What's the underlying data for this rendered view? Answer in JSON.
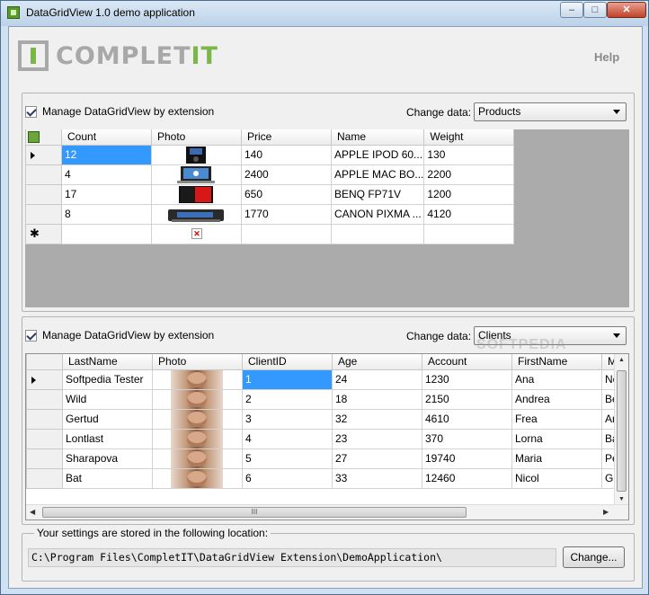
{
  "window": {
    "title": "DataGridView 1.0 demo application",
    "min_glyph": "–",
    "max_glyph": "□",
    "close_glyph": "✕"
  },
  "logo": {
    "text_a": "COMPLET",
    "text_b": "IT"
  },
  "help_label": "Help",
  "products_panel": {
    "checkbox_label": "Manage DataGridView by extension",
    "change_data_label": "Change data:",
    "selected_option": "Products",
    "columns": [
      "Count",
      "Photo",
      "Price",
      "Name",
      "Weight"
    ],
    "rows": [
      {
        "count": "12",
        "price": "140",
        "name": "APPLE IPOD 60...",
        "weight": "130"
      },
      {
        "count": "4",
        "price": "2400",
        "name": "APPLE MAC BO...",
        "weight": "2200"
      },
      {
        "count": "17",
        "price": "650",
        "name": "BENQ FP71V",
        "weight": "1200"
      },
      {
        "count": "8",
        "price": "1770",
        "name": "CANON PIXMA ...",
        "weight": "4120"
      }
    ],
    "new_row_glyph": "✱",
    "broken_glyph": "✕"
  },
  "clients_panel": {
    "checkbox_label": "Manage DataGridView by extension",
    "change_data_label": "Change data:",
    "selected_option": "Clients",
    "columns": [
      "LastName",
      "Photo",
      "ClientID",
      "Age",
      "Account",
      "FirstName",
      "M"
    ],
    "rows": [
      {
        "lastname": "Softpedia Tester",
        "clientid": "1",
        "age": "24",
        "account": "1230",
        "firstname": "Ana",
        "m": "Ne"
      },
      {
        "lastname": "Wild",
        "clientid": "2",
        "age": "18",
        "account": "2150",
        "firstname": "Andrea",
        "m": "Be"
      },
      {
        "lastname": "Gertud",
        "clientid": "3",
        "age": "32",
        "account": "4610",
        "firstname": "Frea",
        "m": "Ar"
      },
      {
        "lastname": "Lontlast",
        "clientid": "4",
        "age": "23",
        "account": "370",
        "firstname": "Lorna",
        "m": "Ba"
      },
      {
        "lastname": "Sharapova",
        "clientid": "5",
        "age": "27",
        "account": "19740",
        "firstname": "Maria",
        "m": "Pe"
      },
      {
        "lastname": "Bat",
        "clientid": "6",
        "age": "33",
        "account": "12460",
        "firstname": "Nicol",
        "m": "Gr"
      }
    ],
    "hscroll_grip": "III"
  },
  "watermark": "SOFTPEDIA",
  "settings": {
    "legend": "Your settings are stored in the following location:",
    "path": "C:\\Program Files\\CompletIT\\DataGridView Extension\\DemoApplication\\",
    "change_button": "Change..."
  }
}
